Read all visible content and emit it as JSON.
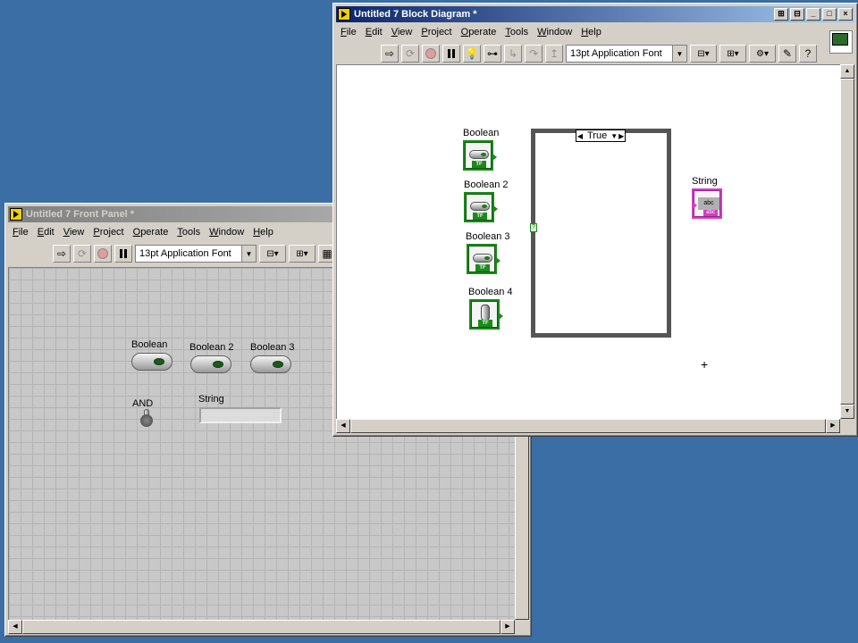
{
  "front_panel": {
    "title": "Untitled 7 Front Panel *",
    "menu": [
      {
        "u": "F",
        "rest": "ile"
      },
      {
        "u": "E",
        "rest": "dit"
      },
      {
        "u": "V",
        "rest": "iew"
      },
      {
        "u": "P",
        "rest": "roject"
      },
      {
        "u": "O",
        "rest": "perate"
      },
      {
        "u": "T",
        "rest": "ools"
      },
      {
        "u": "W",
        "rest": "indow"
      },
      {
        "u": "H",
        "rest": "elp"
      }
    ],
    "font": "13pt Application Font",
    "controls": {
      "boolean": "Boolean",
      "boolean2": "Boolean 2",
      "boolean3": "Boolean 3",
      "and": "AND",
      "string": "String"
    }
  },
  "block_diagram": {
    "title": "Untitled 7 Block Diagram *",
    "menu": [
      {
        "u": "F",
        "rest": "ile"
      },
      {
        "u": "E",
        "rest": "dit"
      },
      {
        "u": "V",
        "rest": "iew"
      },
      {
        "u": "P",
        "rest": "roject"
      },
      {
        "u": "O",
        "rest": "perate"
      },
      {
        "u": "T",
        "rest": "ools"
      },
      {
        "u": "W",
        "rest": "indow"
      },
      {
        "u": "H",
        "rest": "elp"
      }
    ],
    "font": "13pt Application Font",
    "terminals": {
      "boolean": "Boolean",
      "boolean2": "Boolean 2",
      "boolean3": "Boolean 3",
      "boolean4": "Boolean 4",
      "string": "String",
      "tf": "TF",
      "abc": "abc"
    },
    "case_selector": "True",
    "selector_terminal": "?"
  },
  "icons": {
    "run": "run-arrow-icon",
    "run_continuous": "run-continuously-icon",
    "abort": "abort-icon",
    "pause": "pause-icon",
    "highlight": "highlight-execution-icon",
    "retain": "retain-wire-values-icon",
    "step": "step-icon",
    "align": "align-objects-icon",
    "distribute": "distribute-objects-icon",
    "reorder": "reorder-icon",
    "cleanup": "clean-up-diagram-icon",
    "help": "context-help-icon"
  }
}
